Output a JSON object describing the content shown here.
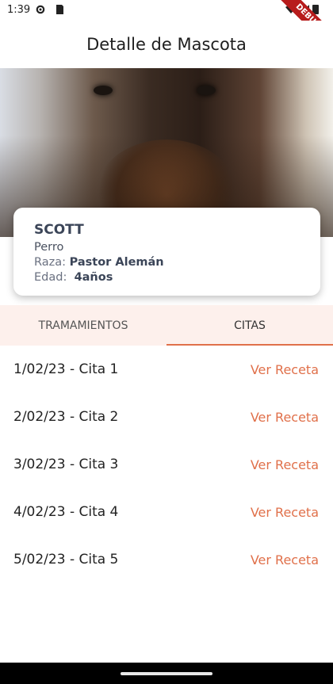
{
  "status_bar": {
    "time": "1:39",
    "debug_label": "DEBUG"
  },
  "app_bar": {
    "title": "Detalle de Mascota"
  },
  "pet": {
    "name": "SCOTT",
    "species": "Perro",
    "breed_label": "Raza:",
    "breed": "Pastor Alemán",
    "age_label": "Edad:",
    "age": "4años"
  },
  "tabs": [
    {
      "label": "TRAMAMIENTOS",
      "active": false
    },
    {
      "label": "CITAS",
      "active": true
    }
  ],
  "appointments": [
    {
      "text": "1/02/23 - Cita 1",
      "action": "Ver Receta"
    },
    {
      "text": "2/02/23 - Cita 2",
      "action": "Ver Receta"
    },
    {
      "text": "3/02/23 - Cita 3",
      "action": "Ver Receta"
    },
    {
      "text": "4/02/23 - Cita 4",
      "action": "Ver Receta"
    },
    {
      "text": "5/02/23 - Cita 5",
      "action": "Ver Receta"
    }
  ],
  "colors": {
    "accent": "#e0704a",
    "tab_bg": "#fdf0ec",
    "card_text": "#3b4558"
  }
}
